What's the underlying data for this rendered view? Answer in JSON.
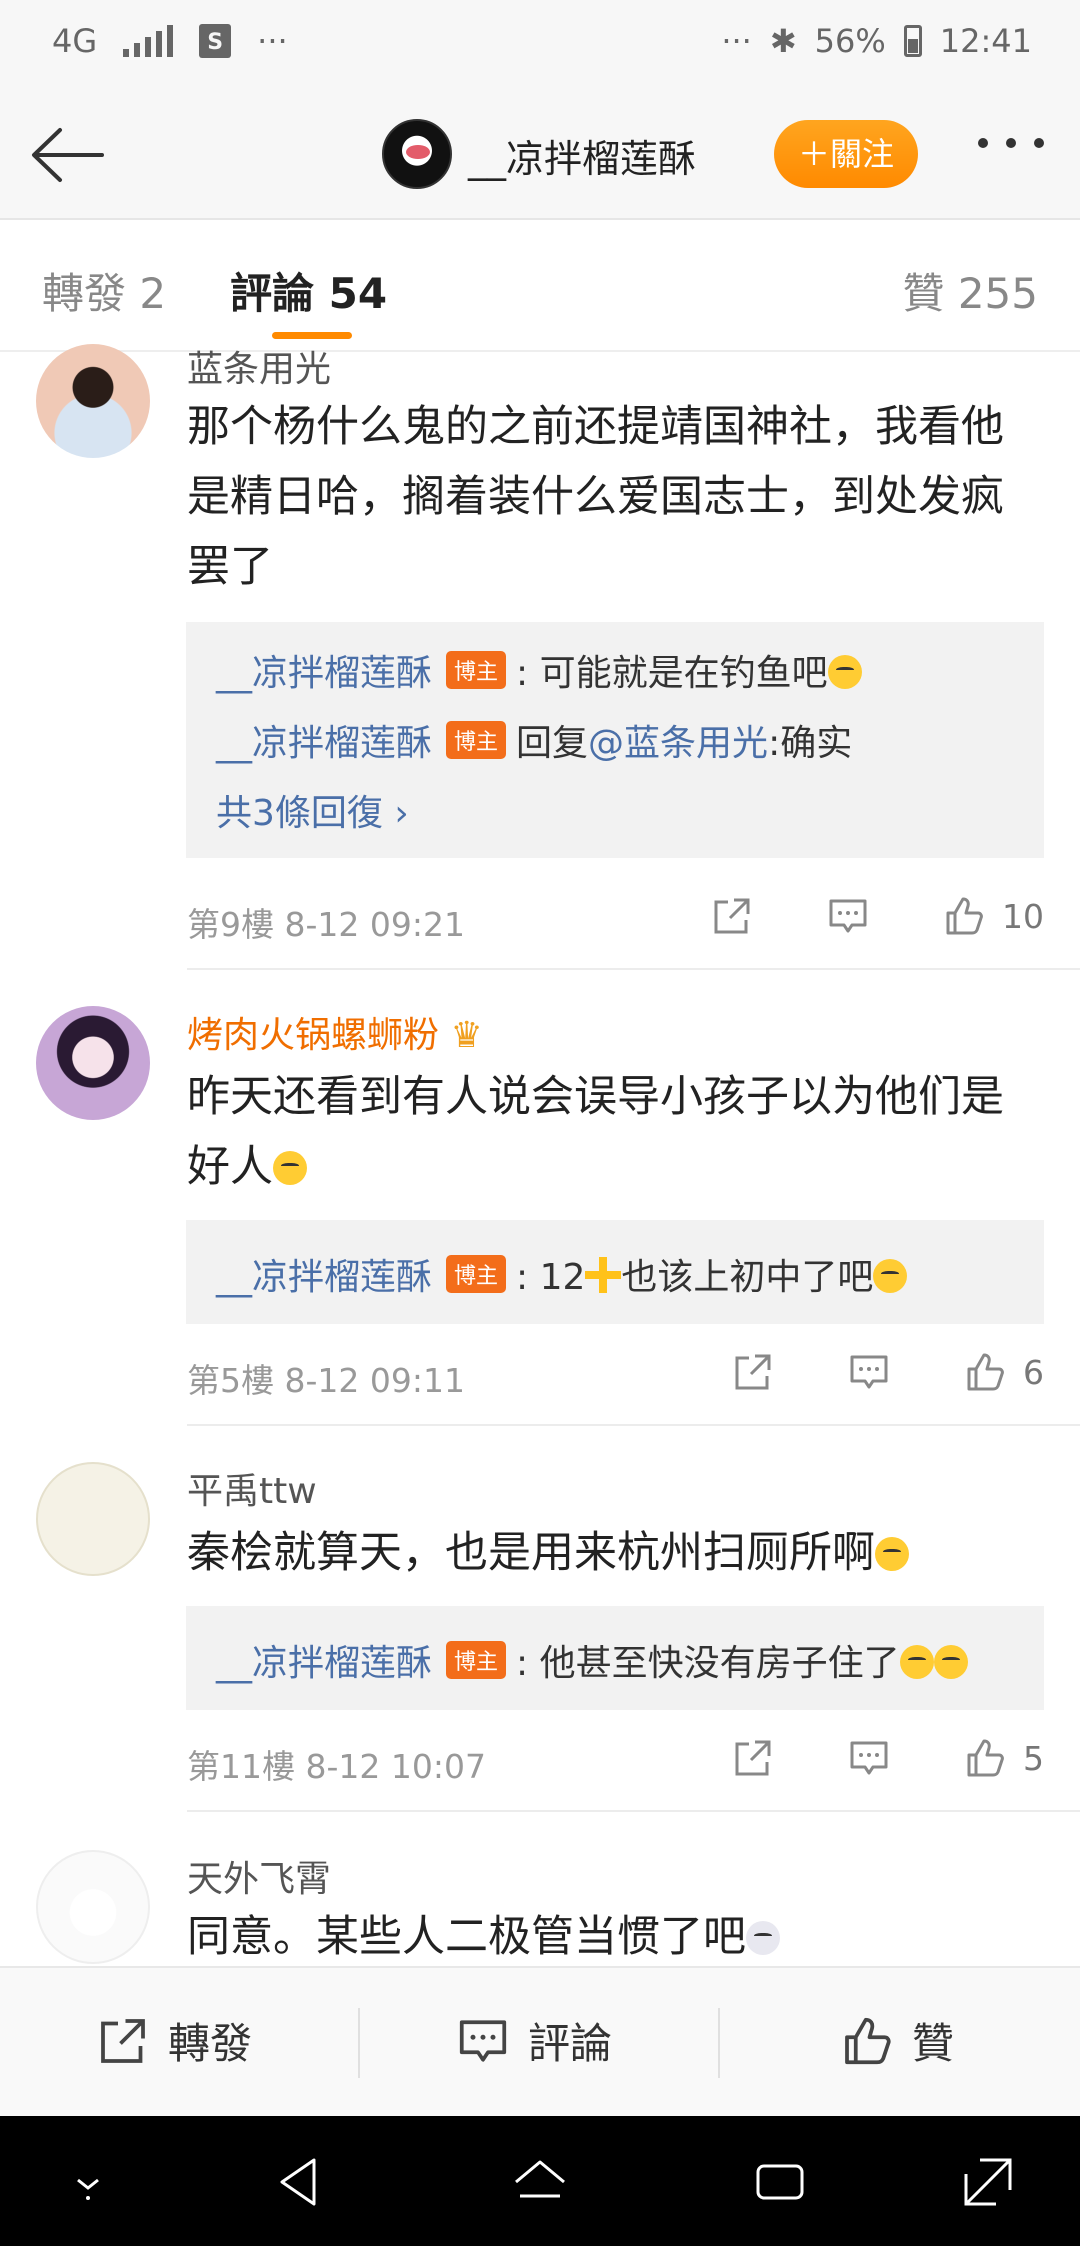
{
  "status_bar": {
    "network": "4G",
    "dots": "···",
    "right_dots": "···",
    "bluetooth": "✱",
    "battery": "56%",
    "time": "12:41"
  },
  "header": {
    "username": "__凉拌榴莲酥",
    "follow_label": "＋關注"
  },
  "tabs": {
    "repost": "轉發 2",
    "comments": "評論 54",
    "likes": "贊 255"
  },
  "comments": [
    {
      "username": "蓝条用光",
      "lines": [
        "那个杨什么鬼的之前还提靖国神社，我看他",
        "是精日哈，搁着装什么爱国志士，到处发疯",
        "罢了"
      ],
      "replies": [
        {
          "name": "__凉拌榴莲酥",
          "badge": "博主",
          "text": ": 可能就是在钓鱼吧"
        },
        {
          "name": "__凉拌榴莲酥",
          "badge": "博主",
          "prefix": "回复",
          "mention": "@蓝条用光",
          "text": ":确实"
        }
      ],
      "more_replies": "共3條回復 ›",
      "meta": "第9樓  8-12 09:21",
      "likes": "10"
    },
    {
      "username": "烤肉火锅螺蛳粉",
      "lines": [
        "昨天还看到有人说会误导小孩子以为他们是",
        "好人"
      ],
      "replies": [
        {
          "name": "__凉拌榴莲酥",
          "badge": "博主",
          "text": ": 12",
          "text2": "也该上初中了吧"
        }
      ],
      "meta": "第5樓  8-12 09:11",
      "likes": "6"
    },
    {
      "username": "平禹ttw",
      "lines": [
        "秦桧就算天，也是用来杭州扫厕所啊"
      ],
      "replies": [
        {
          "name": "__凉拌榴莲酥",
          "badge": "博主",
          "text": ": 他甚至快没有房子住了"
        }
      ],
      "meta": "第11樓  8-12 10:07",
      "likes": "5"
    },
    {
      "username": "天外飞霄",
      "lines": [
        "同意。某些人二极管当惯了吧"
      ]
    }
  ],
  "action_bar": {
    "repost": "轉發",
    "comment": "評論",
    "like": "贊"
  },
  "colors": {
    "accent": "#ff8a00",
    "link": "#4a6fa8",
    "badge": "#f36d1a"
  }
}
